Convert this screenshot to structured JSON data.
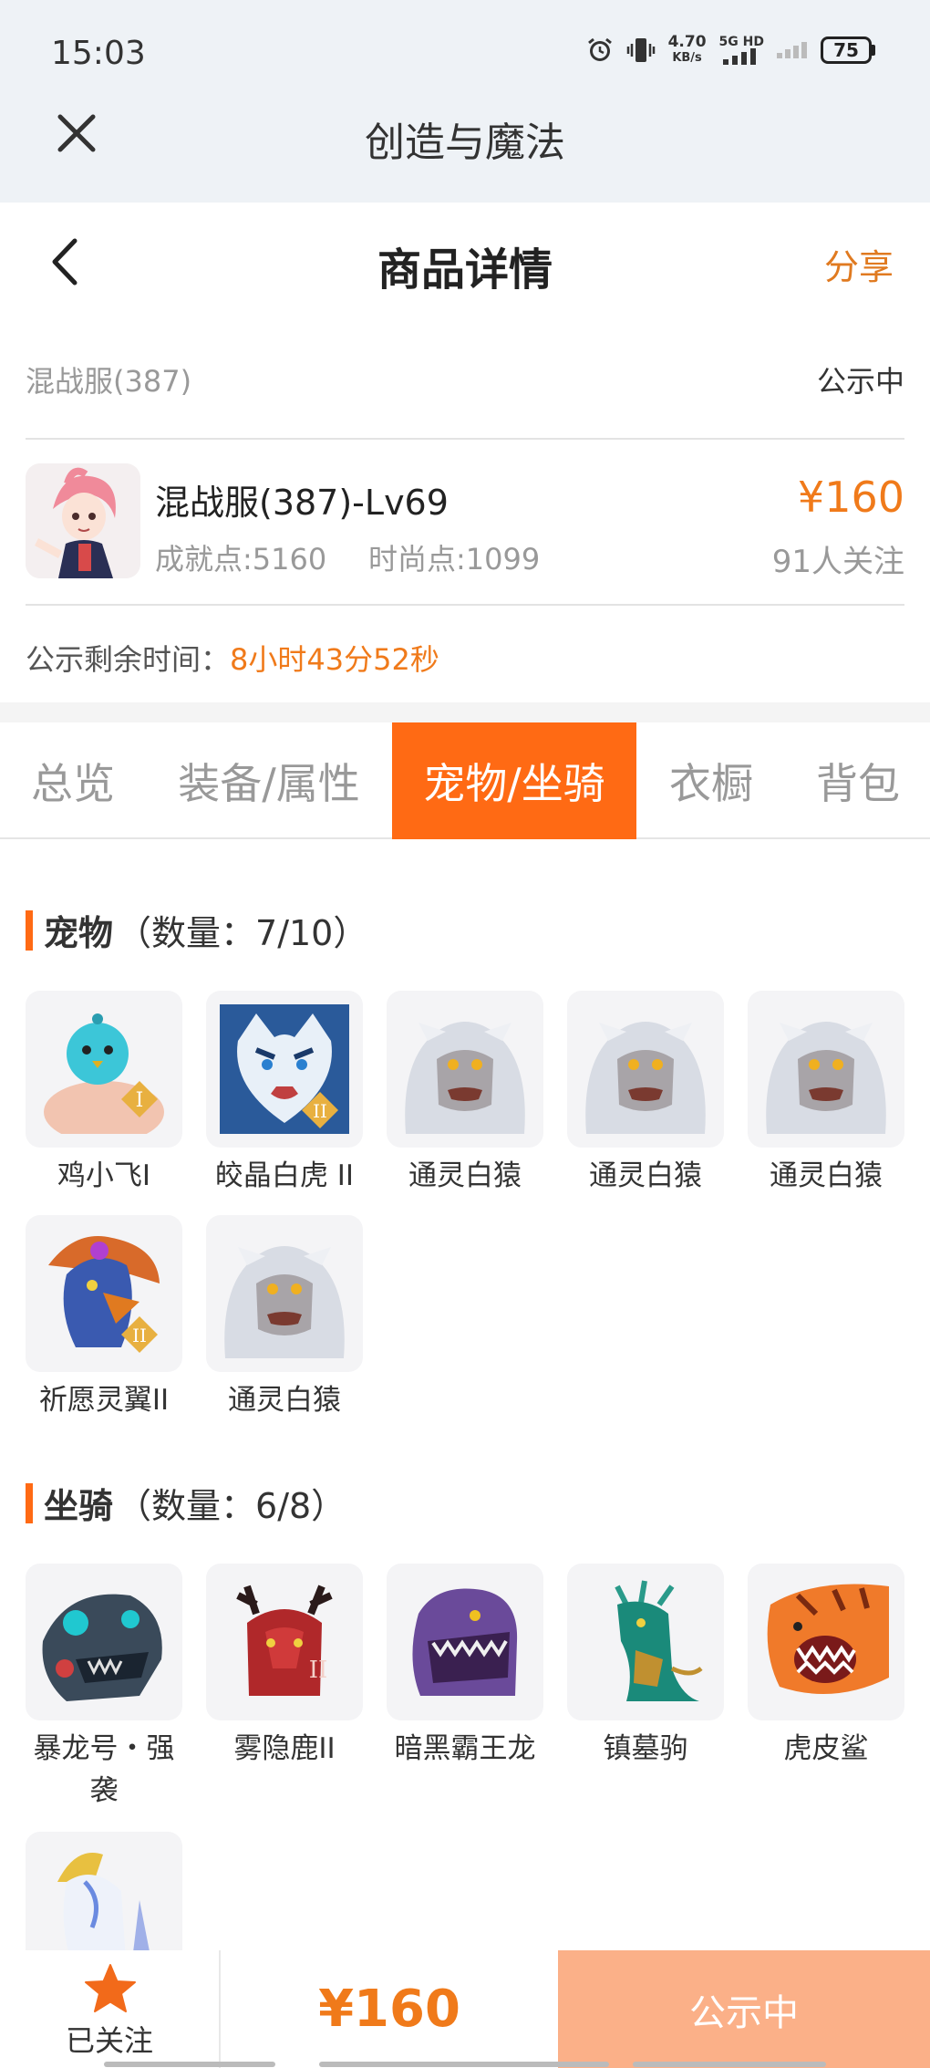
{
  "status_bar": {
    "time": "15:03",
    "net_speed": "4.70",
    "net_unit": "KB/s",
    "net_type": "5G HD",
    "battery": "75"
  },
  "app": {
    "title": "创造与魔法"
  },
  "header": {
    "title": "商品详情",
    "share_label": "分享"
  },
  "info": {
    "server": "混战服(387)",
    "status": "公示中",
    "item_name": "混战服(387)-Lv69",
    "achievement": "成就点:5160",
    "fashion": "时尚点:1099",
    "price": "¥160",
    "followers": "91人关注",
    "timer_label": "公示剩余时间：",
    "timer_value": "8小时43分52秒"
  },
  "tabs": [
    {
      "label": "总览"
    },
    {
      "label": "装备/属性"
    },
    {
      "label": "宠物/坐骑"
    },
    {
      "label": "衣橱"
    },
    {
      "label": "背包"
    }
  ],
  "active_tab": "宠物/坐骑",
  "pets": {
    "title": "宠物",
    "count": "（数量：7/10）",
    "items": [
      {
        "name": "鸡小飞I",
        "icon": "blue-chick-icon"
      },
      {
        "name": "皎晶白虎 II",
        "icon": "white-tiger-icon"
      },
      {
        "name": "通灵白猿",
        "icon": "white-ape-icon"
      },
      {
        "name": "通灵白猿",
        "icon": "white-ape-icon"
      },
      {
        "name": "通灵白猿",
        "icon": "white-ape-icon"
      },
      {
        "name": "祈愿灵翼II",
        "icon": "spirit-bird-icon"
      },
      {
        "name": "通灵白猿",
        "icon": "white-ape-icon"
      }
    ]
  },
  "mounts": {
    "title": "坐骑",
    "count": "（数量：6/8）",
    "items": [
      {
        "name_line1": "暴龙号・强",
        "name_line2": "袭",
        "icon": "mech-dragon-icon"
      },
      {
        "name_line1": "雾隐鹿II",
        "name_line2": "",
        "icon": "red-deer-icon"
      },
      {
        "name_line1": "暗黑霸王龙",
        "name_line2": "",
        "icon": "purple-trex-icon"
      },
      {
        "name_line1": "镇墓驹",
        "name_line2": "",
        "icon": "jade-steed-icon"
      },
      {
        "name_line1": "虎皮鲨",
        "name_line2": "",
        "icon": "tiger-shark-icon"
      },
      {
        "name_line1": "",
        "name_line2": "",
        "icon": "white-unicorn-icon"
      }
    ]
  },
  "bottom": {
    "follow_label": "已关注",
    "price": "¥160",
    "status": "公示中"
  },
  "colors": {
    "accent": "#ff6a14",
    "price": "#f07a1a",
    "status_button": "#fbb088"
  }
}
